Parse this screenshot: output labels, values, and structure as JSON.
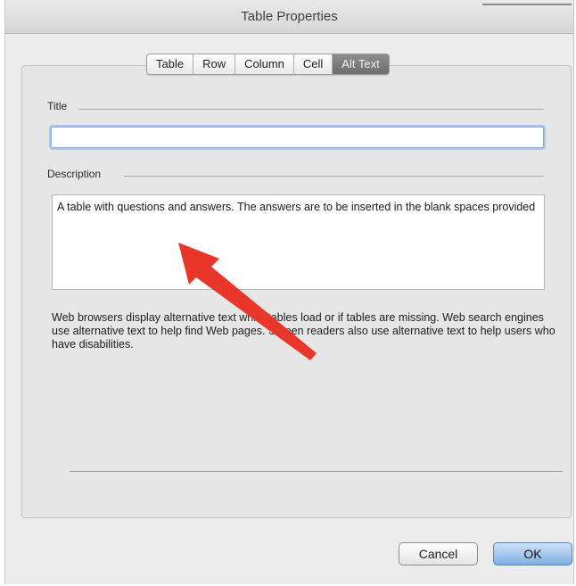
{
  "window": {
    "title": "Table Properties"
  },
  "tabs": [
    {
      "label": "Table",
      "selected": false
    },
    {
      "label": "Row",
      "selected": false
    },
    {
      "label": "Column",
      "selected": false
    },
    {
      "label": "Cell",
      "selected": false
    },
    {
      "label": "Alt Text",
      "selected": true
    }
  ],
  "form": {
    "title_label": "Title",
    "title_value": "",
    "description_label": "Description",
    "description_value": "A table with questions and answers. The answers are to be inserted in the blank spaces provided"
  },
  "help_text": "Web browsers display alternative text while tables load or if tables are missing. Web search engines use alternative text to help find Web pages. Screen readers also use alternative text to help users who have disabilities.",
  "buttons": {
    "cancel": "Cancel",
    "ok": "OK"
  },
  "colors": {
    "annotation_arrow": "#e8362a",
    "ok_button": "#7faee2",
    "focus_ring": "#a9c7e8"
  },
  "icons": {
    "annotation": "red-arrow-icon"
  }
}
